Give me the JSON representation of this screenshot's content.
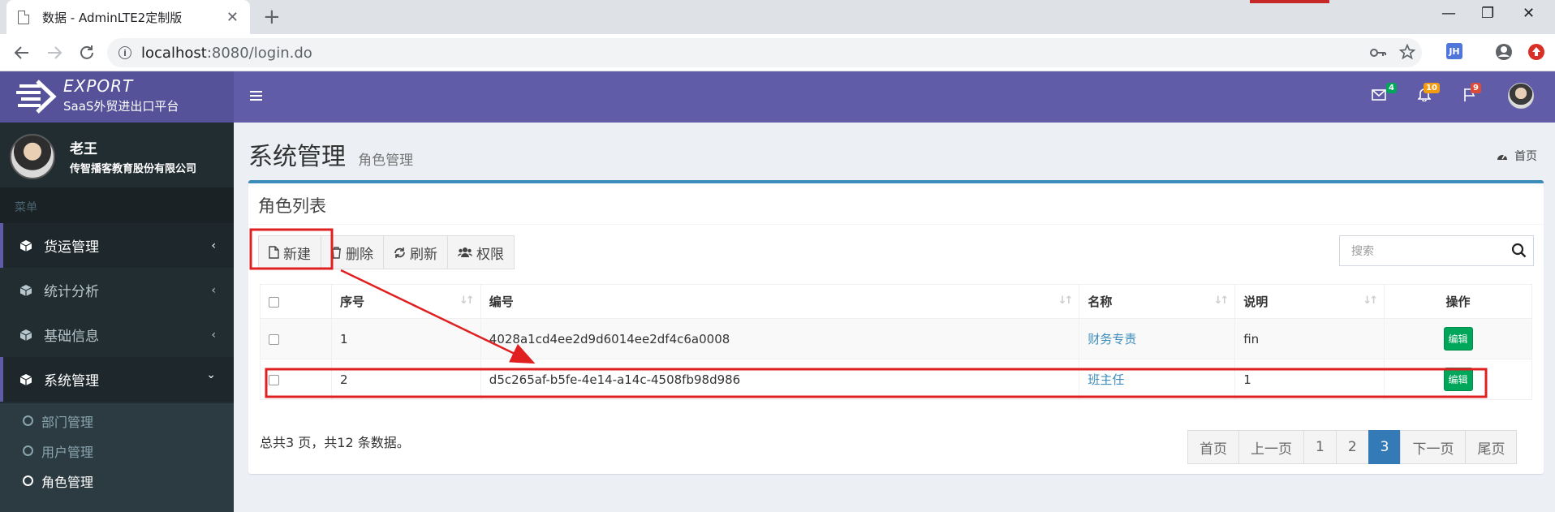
{
  "browser": {
    "tab_title": "数据 - AdminLTE2定制版",
    "tab_close": "✕",
    "new_tab": "+",
    "url_host": "localhost",
    "url_rest": ":8080/login.do",
    "ext_label": "JH",
    "win_min": "—",
    "win_max": "❐",
    "win_close": "✕"
  },
  "logo": {
    "brand": "EXPORT",
    "subtitle": "SaaS外贸进出口平台"
  },
  "header": {
    "mail_badge": "4",
    "bell_badge": "10",
    "flag_badge": "9",
    "colors": {
      "green": "#00a65a",
      "yellow": "#f39c12",
      "red": "#dd4b39"
    }
  },
  "user": {
    "name": "老王",
    "org": "传智播客教育股份有限公司"
  },
  "sidebar": {
    "header": "菜单",
    "items": [
      {
        "label": "货运管理",
        "chevron": "‹"
      },
      {
        "label": "统计分析",
        "chevron": "‹"
      },
      {
        "label": "基础信息",
        "chevron": "‹"
      },
      {
        "label": "系统管理",
        "chevron": "⌄"
      }
    ],
    "sub_items": [
      {
        "label": "部门管理"
      },
      {
        "label": "用户管理"
      },
      {
        "label": "角色管理"
      }
    ]
  },
  "content": {
    "title": "系统管理",
    "subtitle": "角色管理",
    "breadcrumb": "首页",
    "box_title": "角色列表",
    "buttons": {
      "new": "新建",
      "delete": "删除",
      "refresh": "刷新",
      "permission": "权限"
    },
    "search_placeholder": "搜索",
    "table": {
      "headers": [
        "序号",
        "编号",
        "名称",
        "说明",
        "操作"
      ],
      "rows": [
        {
          "no": "1",
          "id": "4028a1cd4ee2d9d6014ee2df4c6a0008",
          "name": "财务专责",
          "desc": "fin",
          "action": "编辑"
        },
        {
          "no": "2",
          "id": "d5c265af-b5fe-4e14-a14c-4508fb98d986",
          "name": "班主任",
          "desc": "1",
          "action": "编辑"
        }
      ]
    },
    "summary": "总共3 页，共12 条数据。",
    "pager": [
      "首页",
      "上一页",
      "1",
      "2",
      "3",
      "下一页",
      "尾页"
    ],
    "pager_active": "3"
  },
  "colors": {
    "topbar": "#605ca8",
    "logo": "#555299",
    "sidebar": "#222d32",
    "accent": "#3c8dbc",
    "annotation": "#e02020"
  }
}
